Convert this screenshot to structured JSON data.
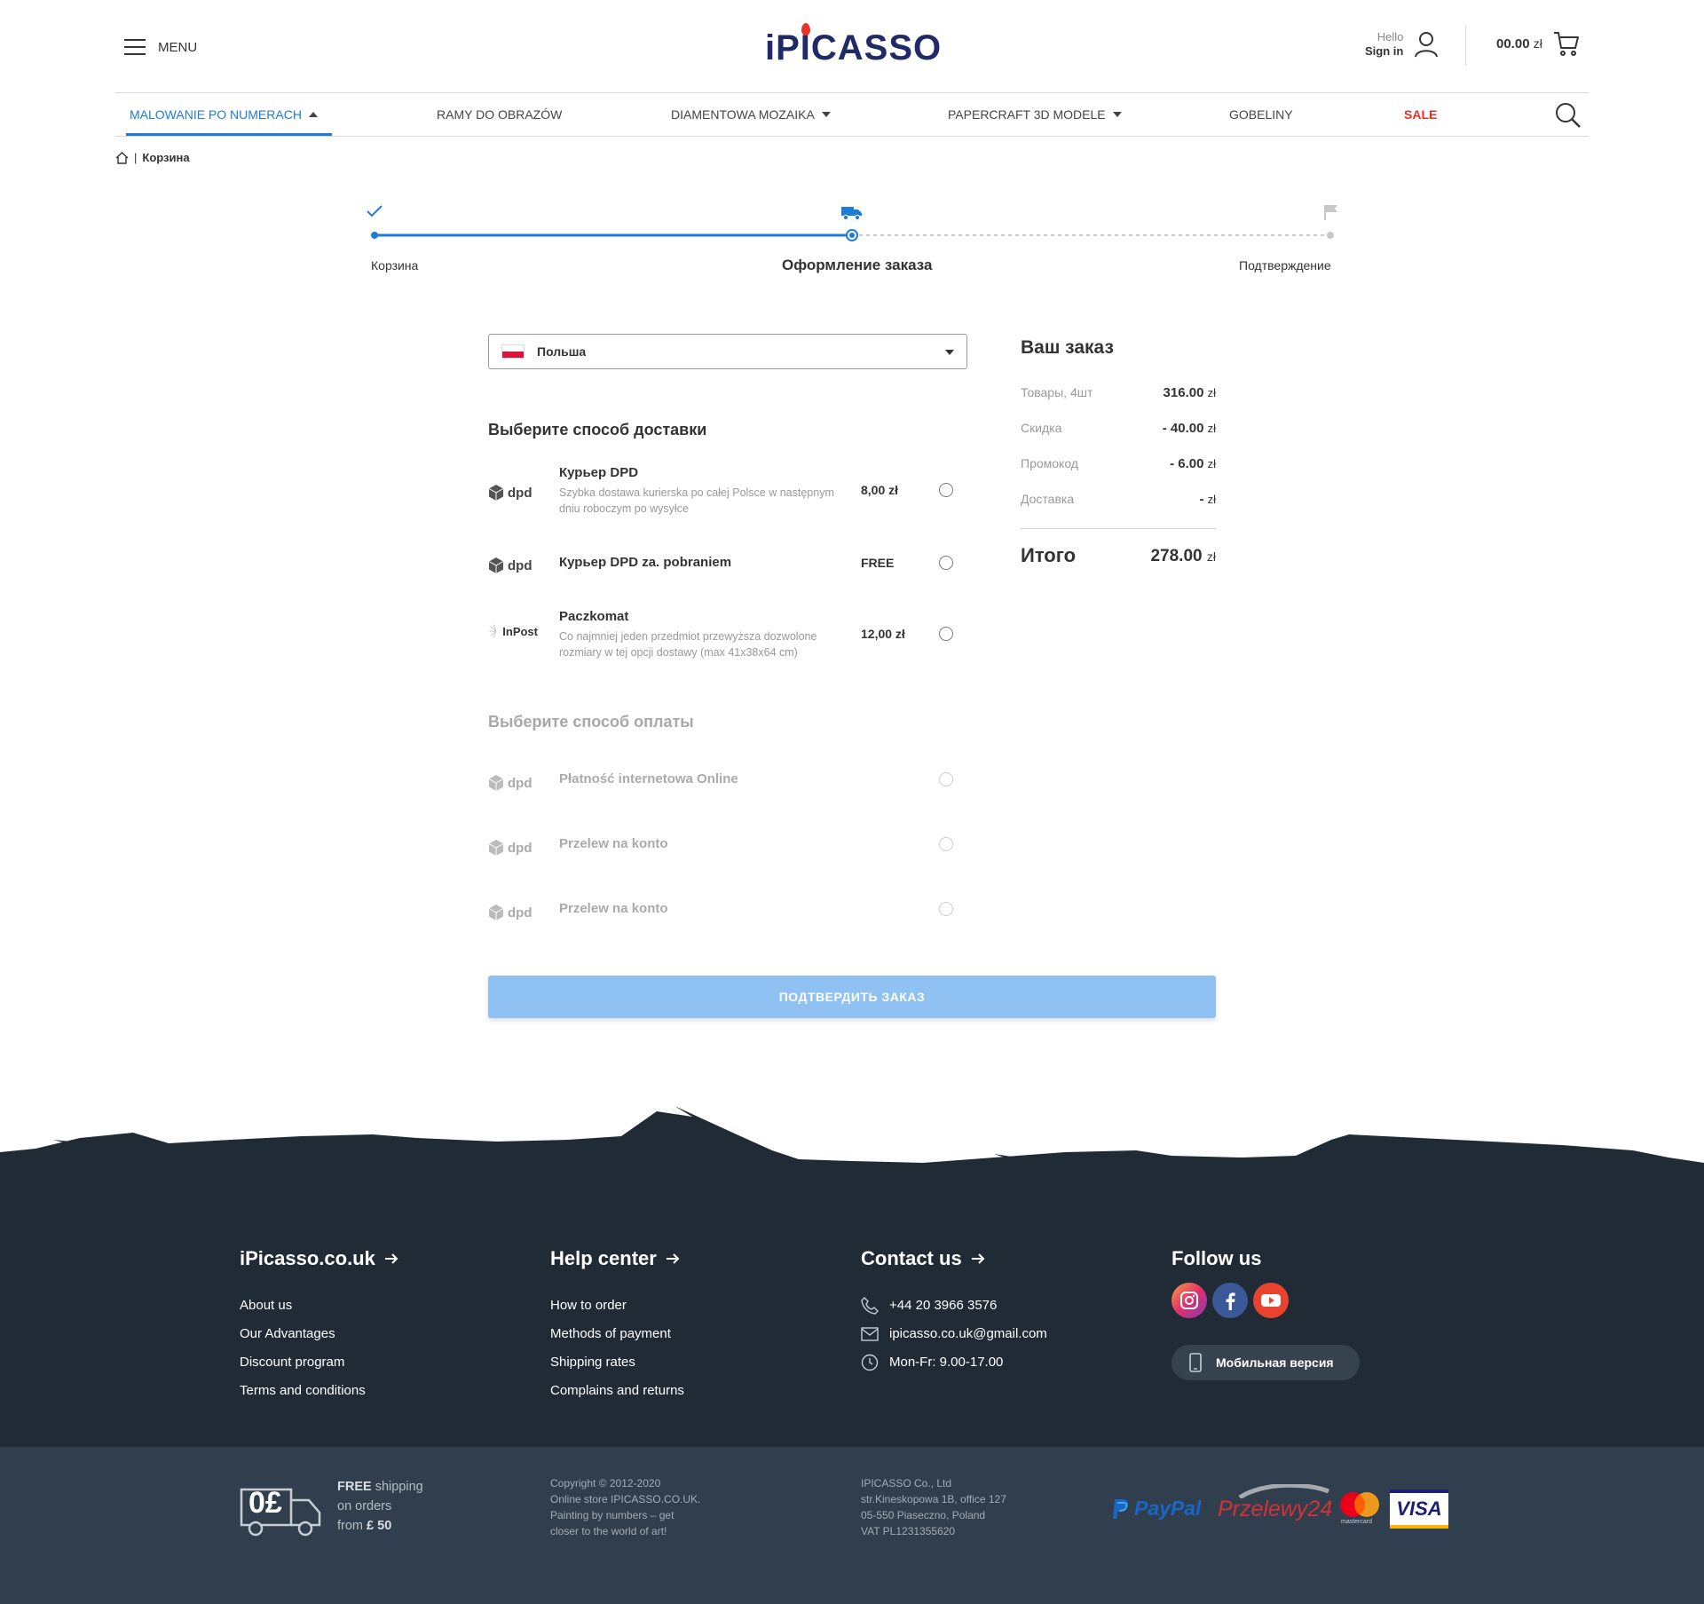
{
  "header": {
    "menu_label": "MENU",
    "logo_text": "iPICASSO",
    "greeting": "Hello",
    "sign_in": "Sign in",
    "cart_amount": "00.00",
    "cart_currency": "zł"
  },
  "nav": {
    "items": [
      {
        "label": "MALOWANIE PO NUMERACH",
        "active": true,
        "has_caret": true
      },
      {
        "label": "RAMY DO OBRAZÓW",
        "active": false,
        "has_caret": false
      },
      {
        "label": "DIAMENTOWA MOZAIKA",
        "active": false,
        "has_caret": true
      },
      {
        "label": "PAPERCRAFT 3D MODELE",
        "active": false,
        "has_caret": true
      },
      {
        "label": "GOBELINY",
        "active": false,
        "has_caret": false
      },
      {
        "label": "SALE",
        "active": false,
        "has_caret": false
      }
    ]
  },
  "breadcrumb": {
    "separator": "|",
    "current": "Корзина"
  },
  "steps": [
    {
      "label": "Корзина",
      "state": "done"
    },
    {
      "label": "Оформление заказа",
      "state": "current"
    },
    {
      "label": "Подтверждение",
      "state": "pending"
    }
  ],
  "country": {
    "value": "Польша"
  },
  "delivery": {
    "title": "Выберите способ доставки",
    "options": [
      {
        "logo": "dpd",
        "name": "Курьер DPD",
        "desc": "Szybka dostawa kurierska po całej Polsce w następnym dniu roboczym po wysyłce",
        "price": "8,00 zł"
      },
      {
        "logo": "dpd",
        "name": "Курьер DPD za. pobraniem",
        "desc": "",
        "price": "FREE"
      },
      {
        "logo": "InPost",
        "name": "Paczkomat",
        "desc": "Co najmniej jeden przedmiot przewyższa dozwolone rozmiary w tej opcji dostawy (max 41x38x64 cm)",
        "price": "12,00 zł"
      }
    ]
  },
  "payment": {
    "title": "Выберите способ оплаты",
    "options": [
      {
        "logo": "dpd",
        "name": "Płatność internetowa Online"
      },
      {
        "logo": "dpd",
        "name": "Przelew na konto"
      },
      {
        "logo": "dpd",
        "name": "Przelew na konto"
      }
    ]
  },
  "summary": {
    "title": "Ваш заказ",
    "rows": [
      {
        "label": "Товары, 4шт",
        "value": "316.00",
        "currency": "zł"
      },
      {
        "label": "Скидка",
        "value": "- 40.00",
        "currency": "zł"
      },
      {
        "label": "Промокод",
        "value": "- 6.00",
        "currency": "zł"
      },
      {
        "label": "Доставка",
        "value": "-",
        "currency": "zł"
      }
    ],
    "total_label": "Итого",
    "total_value": "278.00",
    "total_currency": "zł"
  },
  "confirm_button": "ПОДТВЕРДИТЬ ЗАКАЗ",
  "footer": {
    "columns": [
      {
        "title": "iPicasso.co.uk",
        "links": [
          "About us",
          "Our Advantages",
          "Discount program",
          "Terms and conditions"
        ]
      },
      {
        "title": "Help center",
        "links": [
          "How to order",
          "Methods of payment",
          "Shipping rates",
          "Complains and returns"
        ]
      }
    ],
    "contact": {
      "title": "Contact us",
      "phone": "+44 20 3966 3576",
      "email": "ipicasso.co.uk@gmail.com",
      "hours": "Mon-Fr: 9.00-17.00"
    },
    "follow": {
      "title": "Follow us",
      "mobile_button": "Мобильная версия"
    },
    "shipping": {
      "badge": "0£",
      "free": "FREE",
      "line1": "shipping",
      "line2": "on orders",
      "line3": "from",
      "amount": "£ 50"
    },
    "copyright": [
      "Copyright © 2012-2020",
      "Online store IPICASSO.CO.UK.",
      "Painting by numbers – get",
      "closer to the world of art!"
    ],
    "company": [
      "IPICASSO Co., Ltd",
      "str.Kineskopowa 1B, office 127",
      "05-550 Piaseczno, Poland",
      "VAT PL1231355620"
    ],
    "payment_logos": [
      "PayPal",
      "Przelewy24",
      "mastercard",
      "VISA"
    ]
  },
  "colors": {
    "accent": "#1e7bd8",
    "sale": "#e2332a",
    "confirm_button": "#8fc2f2",
    "footer_dark": "#212b35",
    "footer_bottom": "#313e4d"
  }
}
